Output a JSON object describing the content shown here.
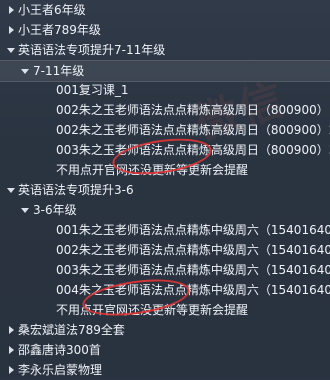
{
  "tree": {
    "items": [
      {
        "label": "小王者6年级"
      },
      {
        "label": "小王者789年级"
      },
      {
        "label": "英语语法专项提升7-11年级"
      },
      {
        "label": "7-11年级"
      },
      {
        "label": "001复习课_1"
      },
      {
        "label": "002朱之玉老师语法点点精炼高级周日（800900）1"
      },
      {
        "label": "002朱之玉老师语法点点精炼高级周日（800900）2"
      },
      {
        "label": "003朱之玉老师语法点点精炼高级周日（800900）3"
      },
      {
        "label": "不用点开官网还没更新等更新会提醒"
      },
      {
        "label": "英语语法专项提升3-6"
      },
      {
        "label": "3-6年级"
      },
      {
        "label": "001朱之玉老师语法点点精炼中级周六（15401640）"
      },
      {
        "label": "002朱之玉老师语法点点精炼中级周六（15401640）"
      },
      {
        "label": "003朱之玉老师语法点点精炼中级周六（15401640）"
      },
      {
        "label": "004朱之玉老师语法点点精炼中级周六（15401640）"
      },
      {
        "label": "不用点开官网还没更新等更新会提醒"
      },
      {
        "label": "桑宏斌道法789全套"
      },
      {
        "label": "邵鑫唐诗300首"
      },
      {
        "label": "李永乐启蒙物理"
      }
    ]
  },
  "watermark": {
    "text": "微信"
  },
  "colors": {
    "background": "#2b3442",
    "text": "#eef3f8",
    "annotation": "#e63434"
  }
}
